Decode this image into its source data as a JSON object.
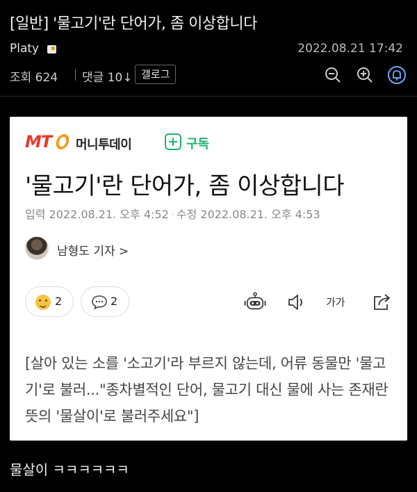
{
  "post": {
    "title": "[일반] '물고기'란 단어가, 좀 이상합니다",
    "author": "Platy",
    "datetime": "2022.08.21 17:42",
    "views_label": "조회 624",
    "comments_label": "댓글 10↓",
    "gallery_tag": "갤로그",
    "tools": [
      "zoom-out-icon",
      "zoom-in-icon",
      "bell-icon"
    ],
    "accent_color": "#6ea8ff"
  },
  "article": {
    "publisher_name": "머니투데이",
    "logo_text": "MT",
    "subscribe_label": "구독",
    "headline": "'물고기'란 단어가, 좀 이상합니다",
    "published": "입력 2022.08.21. 오후 4:52",
    "separator": "·",
    "modified": "수정 2022.08.21. 오후 4:53",
    "reporter": "남형도 기자 >",
    "reactions": [
      {
        "icon": "smile-emoji-icon",
        "count": "2"
      },
      {
        "icon": "comment-bubble-icon",
        "count": "2"
      }
    ],
    "tools": [
      "robot-tts-icon",
      "speaker-icon",
      "font-size-icon",
      "share-icon"
    ],
    "font_size_label": "가가",
    "summary": "[살아 있는 소를 '소고기'라 부르지 않는데, 어류 동물만 '물고기'로 불러...\"종차별적인 단어, 물고기 대신 물에 사는 존재란 뜻의 '물살이'로 불러주세요\"]",
    "brand_colors": {
      "red": "#e8382c",
      "orange": "#f39a1c",
      "green": "#1db46f"
    }
  },
  "comment": {
    "text": "물살이 ㅋㅋㅋㅋㅋㅋ"
  }
}
